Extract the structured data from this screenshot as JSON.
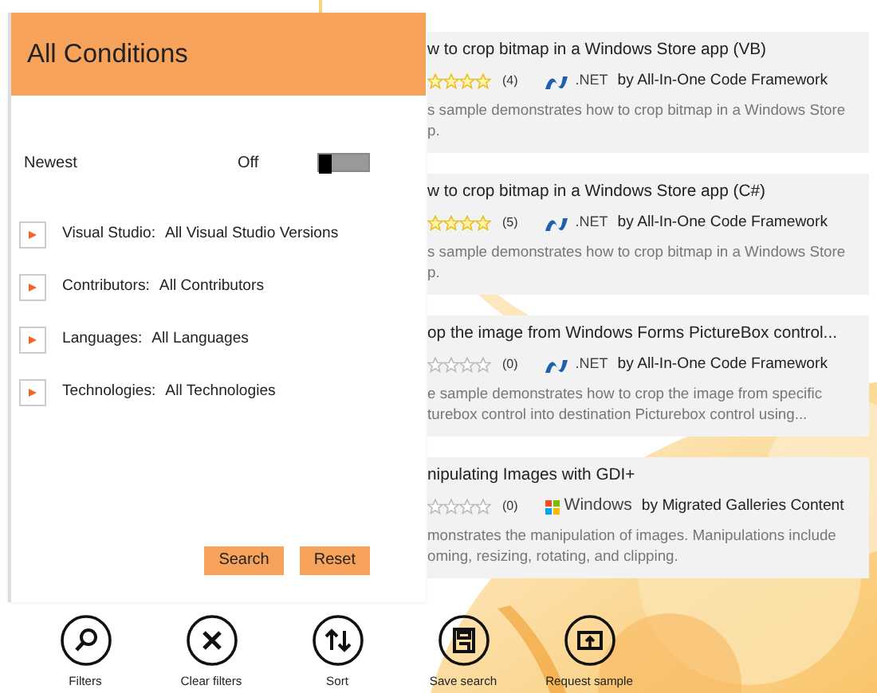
{
  "panel": {
    "title": "All Conditions",
    "newest": {
      "label": "Newest",
      "state_text": "Off",
      "on": false
    },
    "filters": [
      {
        "label": "Visual Studio:",
        "value": "All Visual Studio Versions",
        "expanded": false
      },
      {
        "label": "Contributors:",
        "value": "All Contributors",
        "expanded": false
      },
      {
        "label": "Languages:",
        "value": "All Languages",
        "expanded": false
      },
      {
        "label": "Technologies:",
        "value": "All Technologies",
        "expanded": false
      }
    ],
    "buttons": [
      "Search",
      "Reset"
    ]
  },
  "results": [
    {
      "title": "w to crop bitmap in a Windows Store app (VB)",
      "stars": 4,
      "rating_count": "(4)",
      "platform": {
        "kind": "dotnet",
        "label": ".NET"
      },
      "author": "by All-In-One Code Framework",
      "description_lines": [
        "s sample demonstrates how to crop bitmap in a Windows Store",
        "p."
      ]
    },
    {
      "title": "w to crop bitmap in a Windows Store app (C#)",
      "stars": 4,
      "rating_count": "(5)",
      "platform": {
        "kind": "dotnet",
        "label": ".NET"
      },
      "author": "by All-In-One Code Framework",
      "description_lines": [
        "s sample demonstrates how to crop bitmap in a Windows Store",
        "p."
      ]
    },
    {
      "title": "op the image from Windows Forms PictureBox control...",
      "stars": 0,
      "rating_count": "(0)",
      "platform": {
        "kind": "dotnet",
        "label": ".NET"
      },
      "author": "by All-In-One Code Framework",
      "description_lines": [
        "e sample demonstrates how to crop the image from specific",
        "turebox control into destination Picturebox control using..."
      ]
    },
    {
      "title": "nipulating Images with GDI+",
      "stars": 0,
      "rating_count": "(0)",
      "platform": {
        "kind": "windows",
        "label": "Windows"
      },
      "author": "by Migrated Galleries Content",
      "description_lines": [
        "monstrates the manipulation of images. Manipulations include",
        "oming, resizing, rotating, and clipping."
      ]
    }
  ],
  "app_bar": [
    {
      "kind": "search",
      "label": "Filters"
    },
    {
      "kind": "clear",
      "label": "Clear filters"
    },
    {
      "kind": "sort",
      "label": "Sort"
    },
    {
      "kind": "save",
      "label": "Save search"
    },
    {
      "kind": "request",
      "label": "Request sample"
    }
  ]
}
